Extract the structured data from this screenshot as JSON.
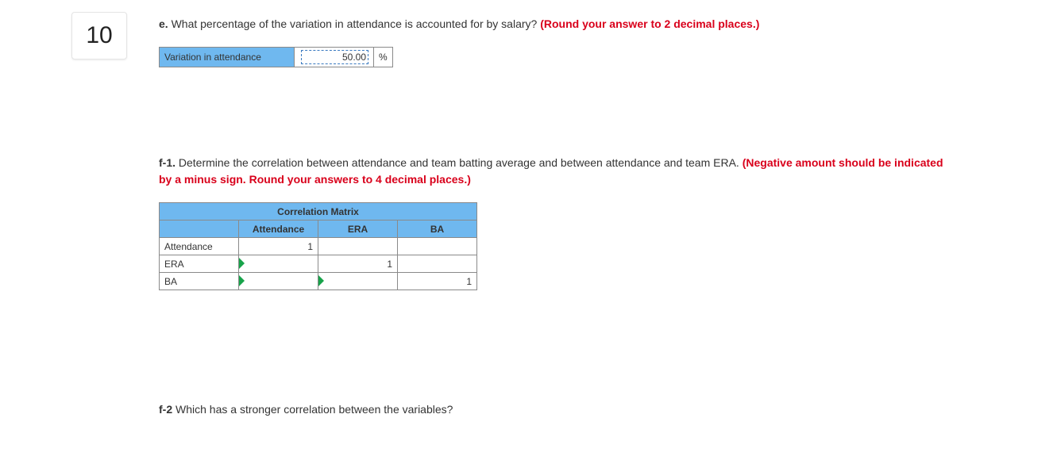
{
  "question_number": "10",
  "part_e": {
    "label": "e.",
    "text": "What percentage of the variation in attendance is accounted for by salary? ",
    "hint": "(Round your answer to 2 decimal places.)",
    "row_label": "Variation in attendance",
    "value": "50.00",
    "unit": "%"
  },
  "part_f1": {
    "label": "f-1.",
    "text": "Determine the correlation between attendance and team batting average and between attendance and team ERA. ",
    "hint": "(Negative amount should be indicated by a minus sign. Round your answers to 4 decimal places.)",
    "matrix_title": "Correlation Matrix",
    "cols": [
      "Attendance",
      "ERA",
      "BA"
    ],
    "rows": [
      "Attendance",
      "ERA",
      "BA"
    ],
    "values": {
      "att_att": "1",
      "era_era": "1",
      "ba_ba": "1"
    }
  },
  "part_f2": {
    "label": "f-2",
    "text": "Which has a stronger correlation between the variables?"
  }
}
